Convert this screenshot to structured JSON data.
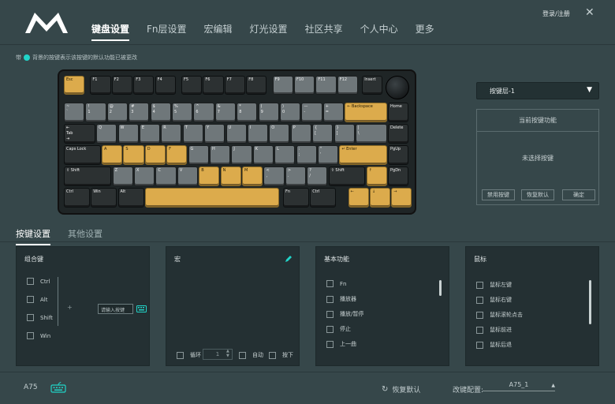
{
  "header": {
    "nav": [
      "键盘设置",
      "Fn层设置",
      "宏编辑",
      "灯光设置",
      "社区共享",
      "个人中心",
      "更多"
    ],
    "active_index": 0,
    "login": "登录/注册",
    "close_icon": "close-icon"
  },
  "hint": {
    "prefix": "带",
    "text": "背景的按键表示该按键的默认功能已被更改",
    "dot_color": "#21d4c8"
  },
  "keyboard": {
    "rows": [
      [
        [
          "Esc",
          "y"
        ],
        [
          "F1",
          "d"
        ],
        [
          "F2",
          "d"
        ],
        [
          "F3",
          "d"
        ],
        [
          "F4",
          "d"
        ],
        [
          "F5",
          "d"
        ],
        [
          "F6",
          "d"
        ],
        [
          "F7",
          "d"
        ],
        [
          "F8",
          "d"
        ],
        [
          "F9",
          "m"
        ],
        [
          "F10",
          "m"
        ],
        [
          "F11",
          "m"
        ],
        [
          "F12",
          "m"
        ],
        [
          "Insert",
          "d"
        ]
      ],
      [
        [
          "~\n`",
          "m"
        ],
        [
          "!\n1",
          "m"
        ],
        [
          "@\n2",
          "m"
        ],
        [
          "#\n3",
          "m"
        ],
        [
          "$\n4",
          "m"
        ],
        [
          "%\n5",
          "m"
        ],
        [
          "^\n6",
          "m"
        ],
        [
          "&\n7",
          "m"
        ],
        [
          "*\n8",
          "m"
        ],
        [
          "(\n9",
          "m"
        ],
        [
          ")\n0",
          "m"
        ],
        [
          "—\n-",
          "m"
        ],
        [
          "+\n=",
          "m"
        ],
        [
          "← Backspace",
          "y"
        ],
        [
          "Home",
          "d"
        ]
      ],
      [
        [
          "⇤\nTab\n⇥",
          "d"
        ],
        [
          "Q",
          "m"
        ],
        [
          "W",
          "m"
        ],
        [
          "E",
          "m"
        ],
        [
          "R",
          "m"
        ],
        [
          "T",
          "m"
        ],
        [
          "Y",
          "m"
        ],
        [
          "U",
          "m"
        ],
        [
          "I",
          "m"
        ],
        [
          "O",
          "m"
        ],
        [
          "P",
          "m"
        ],
        [
          "{\n[",
          "m"
        ],
        [
          "}\n]",
          "m"
        ],
        [
          "|\n\\",
          "m"
        ],
        [
          "Delete",
          "d"
        ]
      ],
      [
        [
          "Caps Lock",
          "d"
        ],
        [
          "A",
          "y"
        ],
        [
          "S",
          "y"
        ],
        [
          "D",
          "y"
        ],
        [
          "F",
          "y"
        ],
        [
          "G",
          "m"
        ],
        [
          "H",
          "m"
        ],
        [
          "J",
          "m"
        ],
        [
          "K",
          "m"
        ],
        [
          "L",
          "m"
        ],
        [
          ":\n;",
          "m"
        ],
        [
          "\"\n'",
          "m"
        ],
        [
          "↵ Enter",
          "y"
        ],
        [
          "PgUp",
          "d"
        ]
      ],
      [
        [
          "⇧ Shift",
          "d"
        ],
        [
          "Z",
          "m"
        ],
        [
          "X",
          "m"
        ],
        [
          "C",
          "m"
        ],
        [
          "V",
          "m"
        ],
        [
          "B",
          "y"
        ],
        [
          "N",
          "y"
        ],
        [
          "M",
          "y"
        ],
        [
          "<\n,",
          "m"
        ],
        [
          ">\n.",
          "m"
        ],
        [
          "?\n/",
          "m"
        ],
        [
          "⇧ Shift",
          "d"
        ],
        [
          "↑",
          "y"
        ],
        [
          "PgDn",
          "d"
        ]
      ],
      [
        [
          "Ctrl",
          "d"
        ],
        [
          "Win",
          "d"
        ],
        [
          "Alt",
          "d"
        ],
        [
          "",
          "y"
        ],
        [
          "Fn",
          "d"
        ],
        [
          "Ctrl",
          "d"
        ],
        [
          "←",
          "y"
        ],
        [
          "↓",
          "y"
        ],
        [
          "→",
          "y"
        ]
      ]
    ]
  },
  "right_panel": {
    "layer": "按键层-1",
    "current_title": "当前按键功能",
    "empty_text": "未选择按键",
    "buttons": [
      "禁用按键",
      "恢复默认",
      "确定"
    ]
  },
  "tabs": [
    "按键设置",
    "其他设置"
  ],
  "combo": {
    "title": "组合键",
    "modifiers": [
      "Ctrl",
      "Alt",
      "Shift",
      "Win"
    ],
    "plus": "+",
    "input_placeholder": "请输入按键"
  },
  "macro": {
    "title": "宏",
    "loop_label": "循环",
    "loop_value": "1",
    "auto_label": "自动",
    "press_label": "按下"
  },
  "basic": {
    "title": "基本功能",
    "items": [
      "Fn",
      "播放器",
      "播放/暂停",
      "停止",
      "上一曲"
    ]
  },
  "mouse": {
    "title": "鼠标",
    "items": [
      "鼠标左键",
      "鼠标右键",
      "鼠标滚轮点击",
      "鼠标前进",
      "鼠标后退"
    ]
  },
  "footer": {
    "model": "A75",
    "restore": "恢复默认",
    "config_label": "改键配置:",
    "config_value": "A75_1"
  }
}
